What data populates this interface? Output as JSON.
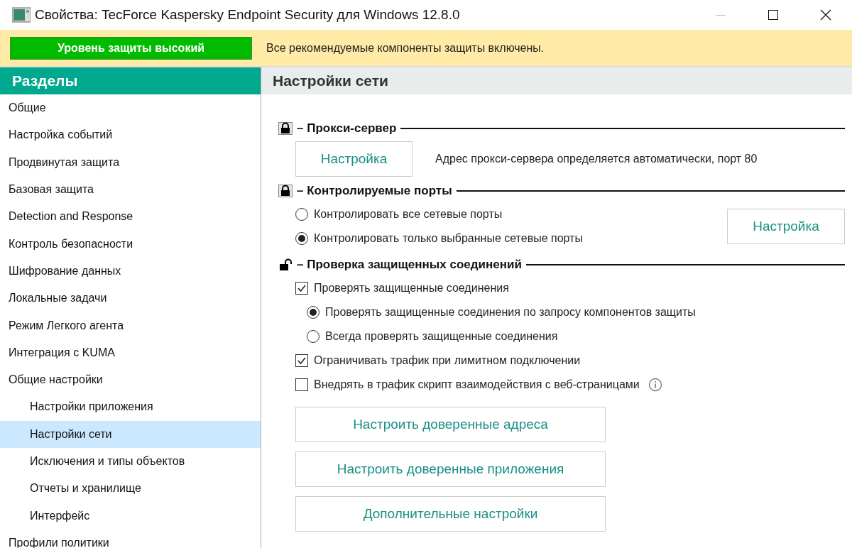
{
  "window": {
    "title": "Свойства: TecForce Kaspersky Endpoint Security для Windows 12.8.0",
    "minimize_disabled": true
  },
  "status": {
    "level": "Уровень защиты высокий",
    "message": "Все рекомендуемые компоненты защиты включены."
  },
  "sidebar": {
    "title": "Разделы",
    "items": [
      {
        "label": "Общие",
        "selected": false
      },
      {
        "label": "Настройка событий",
        "selected": false
      },
      {
        "label": "Продвинутая защита",
        "selected": false
      },
      {
        "label": "Базовая защита",
        "selected": false
      },
      {
        "label": "Detection and Response",
        "selected": false
      },
      {
        "label": "Контроль безопасности",
        "selected": false
      },
      {
        "label": "Шифрование данных",
        "selected": false
      },
      {
        "label": "Локальные задачи",
        "selected": false
      },
      {
        "label": "Режим Легкого агента",
        "selected": false
      },
      {
        "label": "Интеграция с KUMA",
        "selected": false
      },
      {
        "label": "Общие настройки",
        "selected": false,
        "children": [
          {
            "label": "Настройки приложения",
            "selected": false
          },
          {
            "label": "Настройки сети",
            "selected": true
          },
          {
            "label": "Исключения и типы объектов",
            "selected": false
          },
          {
            "label": "Отчеты и хранилище",
            "selected": false
          },
          {
            "label": "Интерфейс",
            "selected": false
          }
        ]
      },
      {
        "label": "Профили политики",
        "selected": false
      }
    ]
  },
  "content": {
    "title": "Настройки сети",
    "sections": [
      {
        "title": "– Прокси-сервер",
        "locked": true,
        "button": "Настройка",
        "note": "Адрес прокси-сервера определяется автоматически, порт 80"
      },
      {
        "title": "– Контролируемые порты",
        "locked": true,
        "side_button": "Настройка",
        "options": [
          {
            "kind": "radio",
            "label": "Контролировать все сетевые порты",
            "checked": false
          },
          {
            "kind": "radio",
            "label": "Контролировать только выбранные сетевые порты",
            "checked": true
          }
        ]
      },
      {
        "title": "– Проверка защищенных соединений",
        "locked": false,
        "options": [
          {
            "kind": "checkbox",
            "label": "Проверять защищенные соединения",
            "checked": true,
            "children": [
              {
                "kind": "radio",
                "label": "Проверять защищенные соединения по запросу компонентов защиты",
                "checked": true
              },
              {
                "kind": "radio",
                "label": "Всегда проверять защищенные соединения",
                "checked": false
              }
            ]
          },
          {
            "kind": "checkbox",
            "label": "Ограничивать трафик при лимитном подключении",
            "checked": true
          },
          {
            "kind": "checkbox",
            "label": "Внедрять в трафик скрипт взаимодействия с веб-страницами",
            "checked": false,
            "info": true
          }
        ]
      }
    ],
    "buttons": [
      "Настроить доверенные адреса",
      "Настроить доверенные приложения",
      "Дополнительные настройки"
    ]
  }
}
